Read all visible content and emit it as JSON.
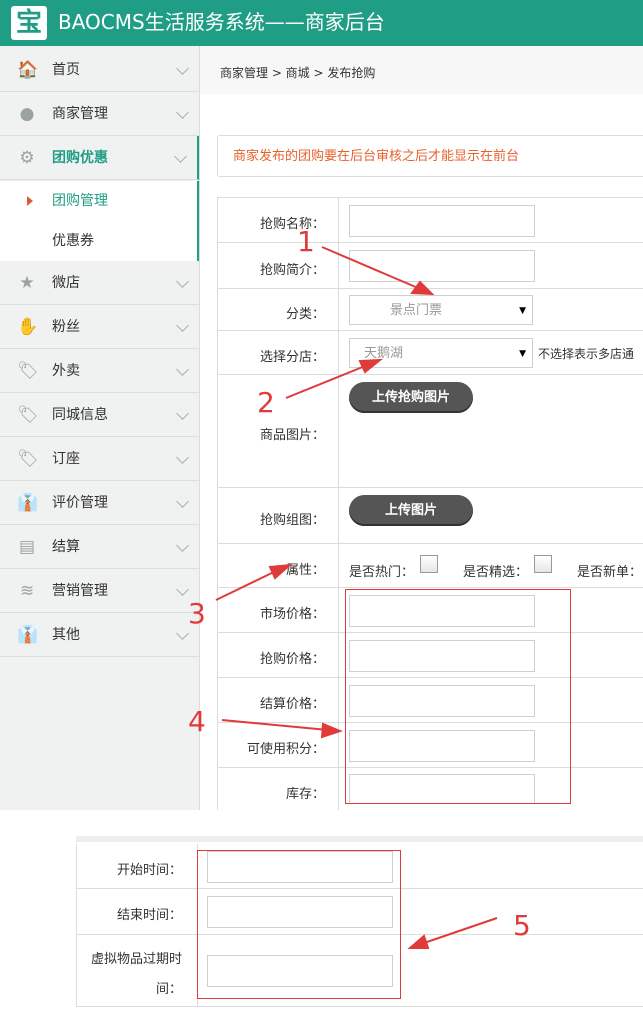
{
  "header": {
    "logo_char": "宝",
    "title": "BAOCMS生活服务系统——商家后台"
  },
  "sidebar": {
    "items": [
      {
        "label": "首页",
        "icon": "🏠"
      },
      {
        "label": "商家管理",
        "icon": "●"
      },
      {
        "label": "团购优惠",
        "icon": "⚙"
      },
      {
        "label": "微店",
        "icon": "★"
      },
      {
        "label": "粉丝",
        "icon": "✋"
      },
      {
        "label": "外卖",
        "icon": "🏷"
      },
      {
        "label": "同城信息",
        "icon": "🏷"
      },
      {
        "label": "订座",
        "icon": "🏷"
      },
      {
        "label": "评价管理",
        "icon": "👔"
      },
      {
        "label": "结算",
        "icon": "▤"
      },
      {
        "label": "营销管理",
        "icon": "≋"
      },
      {
        "label": "其他",
        "icon": "👔"
      }
    ],
    "submenu": [
      {
        "label": "团购管理"
      },
      {
        "label": "优惠券"
      }
    ]
  },
  "breadcrumb": "商家管理 > 商城 > 发布抢购",
  "notice": "商家发布的团购要在后台审核之后才能显示在前台",
  "form": {
    "name_label": "抢购名称：",
    "intro_label": "抢购简介：",
    "category_label": "分类：",
    "category_value": "景点门票",
    "shop_label": "选择分店：",
    "shop_value": "天鹅湖",
    "shop_hint": "不选择表示多店通",
    "image_label": "商品图片：",
    "image_button": "上传抢购图片",
    "gallery_label": "抢购组图：",
    "gallery_button": "上传图片",
    "attr_label": "属性：",
    "attr_hot": "是否热门：",
    "attr_pick": "是否精选：",
    "attr_new": "是否新单：",
    "market_price_label": "市场价格：",
    "sale_price_label": "抢购价格：",
    "settle_price_label": "结算价格：",
    "points_label": "可使用积分：",
    "stock_label": "库存："
  },
  "time_form": {
    "start_label": "开始时间：",
    "end_label": "结束时间：",
    "expire_label_line1": "虚拟物品过期时",
    "expire_label_line2": "间："
  },
  "annotations": {
    "n1": "1",
    "n2": "2",
    "n3": "3",
    "n4": "4",
    "n5": "5",
    "color": "#e03b3b"
  },
  "colors": {
    "brand": "#1f9d85",
    "notice": "#e8612c",
    "annotation": "#e03b3b"
  }
}
